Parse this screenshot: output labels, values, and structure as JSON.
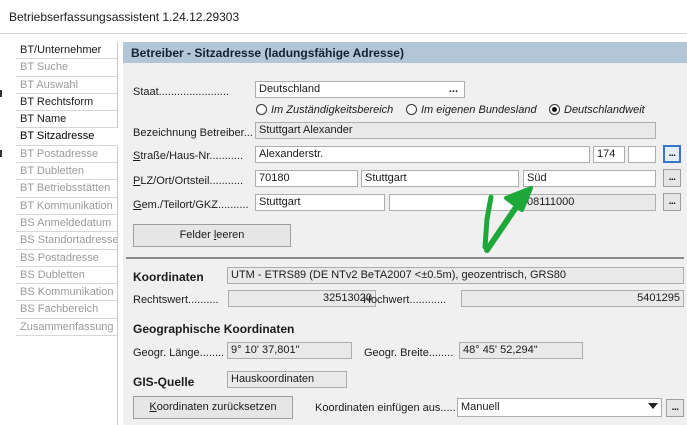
{
  "window": {
    "title": "Betriebserfassungsassistent 1.24.12.29303"
  },
  "sidebar": {
    "items": [
      {
        "label": "BT/Unternehmer",
        "state": "enabled"
      },
      {
        "label": "BT Suche",
        "state": "disabled"
      },
      {
        "label": "BT Auswahl",
        "state": "disabled"
      },
      {
        "label": "BT Rechtsform",
        "state": "enabled"
      },
      {
        "label": "BT Name",
        "state": "enabled"
      },
      {
        "label": "BT Sitzadresse",
        "state": "active"
      },
      {
        "label": "BT Postadresse",
        "state": "disabled"
      },
      {
        "label": "BT Dubletten",
        "state": "disabled"
      },
      {
        "label": "BT Betriebsstätten",
        "state": "disabled"
      },
      {
        "label": "BT Kommunikation",
        "state": "disabled"
      },
      {
        "label": "BS Anmeldedatum",
        "state": "disabled"
      },
      {
        "label": "BS Standortadresse",
        "state": "disabled"
      },
      {
        "label": "BS Postadresse",
        "state": "disabled"
      },
      {
        "label": "BS Dubletten",
        "state": "disabled"
      },
      {
        "label": "BS Kommunikation",
        "state": "disabled"
      },
      {
        "label": "BS Fachbereich",
        "state": "disabled"
      },
      {
        "label": "Zusammenfassung",
        "state": "disabled"
      }
    ]
  },
  "main": {
    "header": "Betreiber - Sitzadresse (ladungsfähige Adresse)",
    "staat": {
      "label": "Staat.......................",
      "value": "Deutschland",
      "button": "..."
    },
    "scope": {
      "options": [
        "Im Zuständigkeitsbereich",
        "Im eigenen Bundesland",
        "Deutschlandweit"
      ],
      "selected": "Deutschlandweit"
    },
    "bezeichnung": {
      "label": "Bezeichnung Betreiber...",
      "value": "Stuttgart Alexander"
    },
    "strasse": {
      "label_key": "S",
      "label_rest": "traße/Haus-Nr...........",
      "street": "Alexanderstr.",
      "number": "174",
      "suffix": "",
      "button": "..."
    },
    "plz": {
      "label_key": "P",
      "label_rest": "LZ/Ort/Ortsteil...........",
      "plz": "70180",
      "ort": "Stuttgart",
      "ortsteil": "Süd",
      "button": "..."
    },
    "gemeinde": {
      "label_key": "G",
      "label_rest": "em./Teilort/GKZ..........",
      "gemeinde": "Stuttgart",
      "teilort": "",
      "gkz": "08111000",
      "button": "..."
    },
    "clear_button": {
      "label_pre": "Felder ",
      "label_key": "l",
      "label_post": "eeren"
    },
    "coords": {
      "title": "Koordinaten",
      "system": "UTM - ETRS89 (DE NTv2 BeTA2007 <±0.5m), geozentrisch, GRS80",
      "rechtswert_label": "Rechtswert..........",
      "rechtswert": "32513020",
      "hochwert_label": "Hochwert............",
      "hochwert": "5401295"
    },
    "geo": {
      "title": "Geographische Koordinaten",
      "laenge_label": "Geogr. Länge........",
      "laenge": "9° 10' 37,801\"",
      "breite_label": "Geogr. Breite........",
      "breite": "48° 45' 52,294\""
    },
    "gis": {
      "title": "GIS-Quelle",
      "value": "Hauskoordinaten",
      "reset_key": "K",
      "reset_rest": "oordinaten zurücksetzen",
      "insert_label": "Koordinaten einfügen aus.....",
      "insert_value": "Manuell",
      "button": "..."
    }
  },
  "annotation": {
    "arrow_color": "#1fa83a"
  },
  "colors": {
    "header_bg": "#b3c6d8",
    "panel_bg": "#f0f0f0",
    "focus_border": "#3b77c8"
  }
}
